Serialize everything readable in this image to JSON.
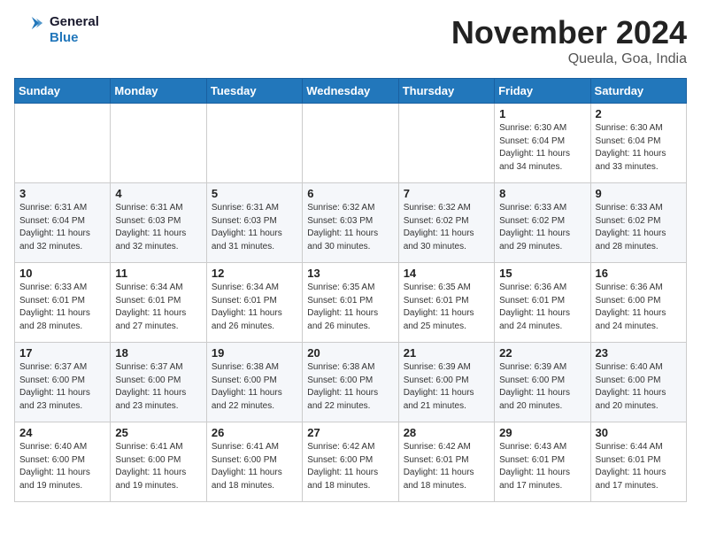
{
  "logo": {
    "text_general": "General",
    "text_blue": "Blue"
  },
  "title": "November 2024",
  "location": "Queula, Goa, India",
  "days_of_week": [
    "Sunday",
    "Monday",
    "Tuesday",
    "Wednesday",
    "Thursday",
    "Friday",
    "Saturday"
  ],
  "weeks": [
    [
      {
        "day": "",
        "info": ""
      },
      {
        "day": "",
        "info": ""
      },
      {
        "day": "",
        "info": ""
      },
      {
        "day": "",
        "info": ""
      },
      {
        "day": "",
        "info": ""
      },
      {
        "day": "1",
        "info": "Sunrise: 6:30 AM\nSunset: 6:04 PM\nDaylight: 11 hours\nand 34 minutes."
      },
      {
        "day": "2",
        "info": "Sunrise: 6:30 AM\nSunset: 6:04 PM\nDaylight: 11 hours\nand 33 minutes."
      }
    ],
    [
      {
        "day": "3",
        "info": "Sunrise: 6:31 AM\nSunset: 6:04 PM\nDaylight: 11 hours\nand 32 minutes."
      },
      {
        "day": "4",
        "info": "Sunrise: 6:31 AM\nSunset: 6:03 PM\nDaylight: 11 hours\nand 32 minutes."
      },
      {
        "day": "5",
        "info": "Sunrise: 6:31 AM\nSunset: 6:03 PM\nDaylight: 11 hours\nand 31 minutes."
      },
      {
        "day": "6",
        "info": "Sunrise: 6:32 AM\nSunset: 6:03 PM\nDaylight: 11 hours\nand 30 minutes."
      },
      {
        "day": "7",
        "info": "Sunrise: 6:32 AM\nSunset: 6:02 PM\nDaylight: 11 hours\nand 30 minutes."
      },
      {
        "day": "8",
        "info": "Sunrise: 6:33 AM\nSunset: 6:02 PM\nDaylight: 11 hours\nand 29 minutes."
      },
      {
        "day": "9",
        "info": "Sunrise: 6:33 AM\nSunset: 6:02 PM\nDaylight: 11 hours\nand 28 minutes."
      }
    ],
    [
      {
        "day": "10",
        "info": "Sunrise: 6:33 AM\nSunset: 6:01 PM\nDaylight: 11 hours\nand 28 minutes."
      },
      {
        "day": "11",
        "info": "Sunrise: 6:34 AM\nSunset: 6:01 PM\nDaylight: 11 hours\nand 27 minutes."
      },
      {
        "day": "12",
        "info": "Sunrise: 6:34 AM\nSunset: 6:01 PM\nDaylight: 11 hours\nand 26 minutes."
      },
      {
        "day": "13",
        "info": "Sunrise: 6:35 AM\nSunset: 6:01 PM\nDaylight: 11 hours\nand 26 minutes."
      },
      {
        "day": "14",
        "info": "Sunrise: 6:35 AM\nSunset: 6:01 PM\nDaylight: 11 hours\nand 25 minutes."
      },
      {
        "day": "15",
        "info": "Sunrise: 6:36 AM\nSunset: 6:01 PM\nDaylight: 11 hours\nand 24 minutes."
      },
      {
        "day": "16",
        "info": "Sunrise: 6:36 AM\nSunset: 6:00 PM\nDaylight: 11 hours\nand 24 minutes."
      }
    ],
    [
      {
        "day": "17",
        "info": "Sunrise: 6:37 AM\nSunset: 6:00 PM\nDaylight: 11 hours\nand 23 minutes."
      },
      {
        "day": "18",
        "info": "Sunrise: 6:37 AM\nSunset: 6:00 PM\nDaylight: 11 hours\nand 23 minutes."
      },
      {
        "day": "19",
        "info": "Sunrise: 6:38 AM\nSunset: 6:00 PM\nDaylight: 11 hours\nand 22 minutes."
      },
      {
        "day": "20",
        "info": "Sunrise: 6:38 AM\nSunset: 6:00 PM\nDaylight: 11 hours\nand 22 minutes."
      },
      {
        "day": "21",
        "info": "Sunrise: 6:39 AM\nSunset: 6:00 PM\nDaylight: 11 hours\nand 21 minutes."
      },
      {
        "day": "22",
        "info": "Sunrise: 6:39 AM\nSunset: 6:00 PM\nDaylight: 11 hours\nand 20 minutes."
      },
      {
        "day": "23",
        "info": "Sunrise: 6:40 AM\nSunset: 6:00 PM\nDaylight: 11 hours\nand 20 minutes."
      }
    ],
    [
      {
        "day": "24",
        "info": "Sunrise: 6:40 AM\nSunset: 6:00 PM\nDaylight: 11 hours\nand 19 minutes."
      },
      {
        "day": "25",
        "info": "Sunrise: 6:41 AM\nSunset: 6:00 PM\nDaylight: 11 hours\nand 19 minutes."
      },
      {
        "day": "26",
        "info": "Sunrise: 6:41 AM\nSunset: 6:00 PM\nDaylight: 11 hours\nand 18 minutes."
      },
      {
        "day": "27",
        "info": "Sunrise: 6:42 AM\nSunset: 6:00 PM\nDaylight: 11 hours\nand 18 minutes."
      },
      {
        "day": "28",
        "info": "Sunrise: 6:42 AM\nSunset: 6:01 PM\nDaylight: 11 hours\nand 18 minutes."
      },
      {
        "day": "29",
        "info": "Sunrise: 6:43 AM\nSunset: 6:01 PM\nDaylight: 11 hours\nand 17 minutes."
      },
      {
        "day": "30",
        "info": "Sunrise: 6:44 AM\nSunset: 6:01 PM\nDaylight: 11 hours\nand 17 minutes."
      }
    ]
  ]
}
